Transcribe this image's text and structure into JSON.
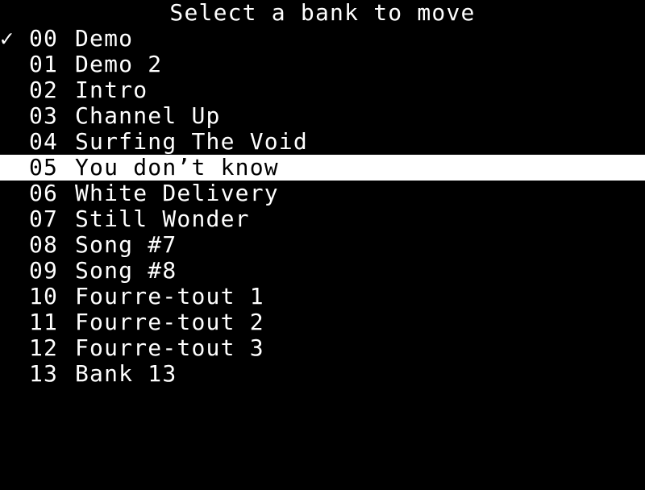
{
  "header": {
    "title": "Select a bank to move"
  },
  "icons": {
    "check": "✓"
  },
  "colors": {
    "background": "#000000",
    "text": "#ffffff",
    "selection_background": "#ffffff",
    "selection_text": "#000000"
  },
  "banks": [
    {
      "number": "00",
      "name": "Demo",
      "checked": true,
      "selected": false
    },
    {
      "number": "01",
      "name": "Demo 2",
      "checked": false,
      "selected": false
    },
    {
      "number": "02",
      "name": "Intro",
      "checked": false,
      "selected": false
    },
    {
      "number": "03",
      "name": "Channel Up",
      "checked": false,
      "selected": false
    },
    {
      "number": "04",
      "name": "Surfing The Void",
      "checked": false,
      "selected": false
    },
    {
      "number": "05",
      "name": "You don’t know",
      "checked": false,
      "selected": true
    },
    {
      "number": "06",
      "name": "White Delivery",
      "checked": false,
      "selected": false
    },
    {
      "number": "07",
      "name": "Still Wonder",
      "checked": false,
      "selected": false
    },
    {
      "number": "08",
      "name": "Song #7",
      "checked": false,
      "selected": false
    },
    {
      "number": "09",
      "name": "Song #8",
      "checked": false,
      "selected": false
    },
    {
      "number": "10",
      "name": "Fourre-tout 1",
      "checked": false,
      "selected": false
    },
    {
      "number": "11",
      "name": "Fourre-tout 2",
      "checked": false,
      "selected": false
    },
    {
      "number": "12",
      "name": "Fourre-tout 3",
      "checked": false,
      "selected": false
    },
    {
      "number": "13",
      "name": "Bank 13",
      "checked": false,
      "selected": false
    }
  ]
}
